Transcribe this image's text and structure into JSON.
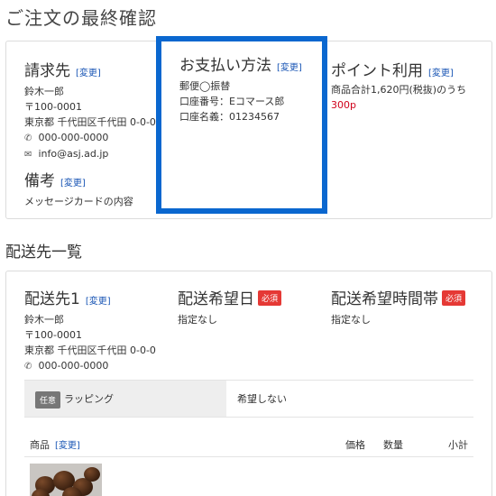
{
  "page_title": "ご注文の最終確認",
  "change_label": "[変更]",
  "billing": {
    "heading": "請求先",
    "name": "鈴木一郎",
    "postal": "〒100-0001",
    "address": "東京都 千代田区千代田 0-0-0",
    "phone": "000-000-0000",
    "email": "info@asj.ad.jp"
  },
  "remarks": {
    "heading": "備考",
    "text": "メッセージカードの内容"
  },
  "payment": {
    "heading": "お支払い方法",
    "method": "郵便◯振替",
    "account_number": "口座番号：Eコマース郎",
    "account_name": "口座名義：01234567"
  },
  "points": {
    "heading": "ポイント利用",
    "text_prefix": "商品合計1,620円(税抜)のうち",
    "points_value": "300p"
  },
  "shipping_list_title": "配送先一覧",
  "destination": {
    "heading": "配送先1",
    "name": "鈴木一郎",
    "postal": "〒100-0001",
    "address": "東京都 千代田区千代田 0-0-0",
    "phone": "000-000-0000"
  },
  "delivery_date": {
    "heading": "配送希望日",
    "required": "必須",
    "value": "指定なし"
  },
  "delivery_time": {
    "heading": "配送希望時間帯",
    "required": "必須",
    "value": "指定なし"
  },
  "wrapping": {
    "optional": "任意",
    "label": "ラッピング",
    "value": "希望しない"
  },
  "products_table": {
    "col_item": "商品",
    "col_price": "価格",
    "col_qty": "数量",
    "col_subtotal": "小計"
  },
  "icons": {
    "phone": "phone-icon",
    "mail": "mail-icon"
  },
  "colors": {
    "accent_border": "#0a67cf",
    "link": "#1a56b5",
    "required_badge": "#e53935",
    "points": "#d0021b"
  }
}
